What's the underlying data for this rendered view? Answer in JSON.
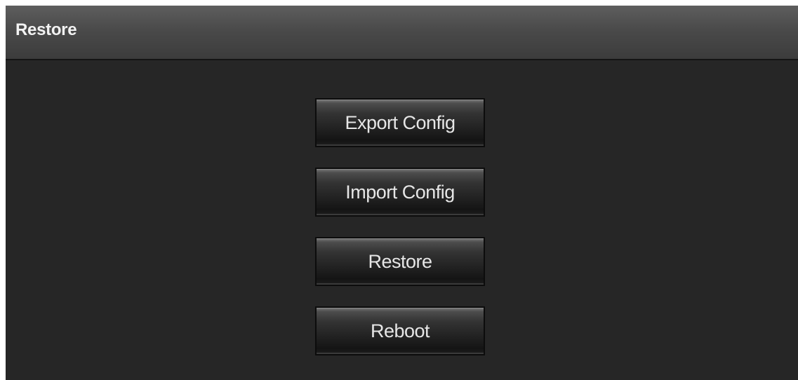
{
  "header": {
    "title": "Restore"
  },
  "actions": {
    "export_label": "Export Config",
    "import_label": "Import Config",
    "restore_label": "Restore",
    "reboot_label": "Reboot"
  },
  "colors": {
    "panel_background": "#262626",
    "header_background": "#4a4a4a",
    "button_text": "#e6e6e6",
    "header_text": "#f2f2f2"
  }
}
